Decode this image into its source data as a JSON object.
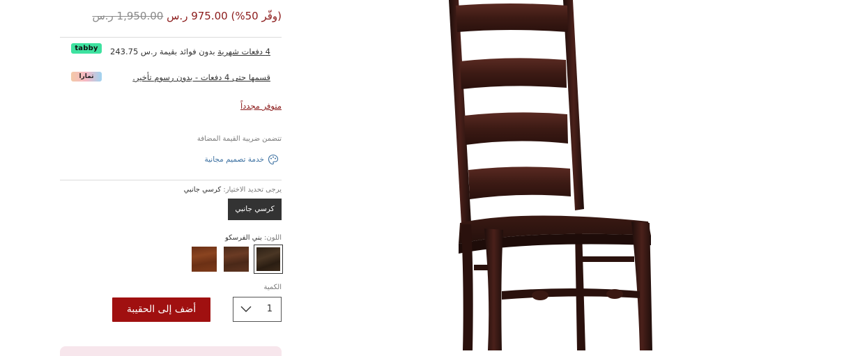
{
  "price": {
    "old": "1,950.00 ر.س",
    "new": "975.00 ر.س",
    "save": "(وفّر 50%)"
  },
  "installments": {
    "tabby_link": "4 دفعات شهرية",
    "tabby_rest": " بدون فوائد بقيمة ر.س 243.75",
    "tabby_logo": "tabby",
    "tabby_color": "#3ee2a0",
    "tamara_text": "قسمها حتى 4 دفعات - بدون رسوم تأخير.",
    "tamara_logo": "تمارا"
  },
  "availability": "متوفر مجدداً",
  "vat_note": "تتضمن ضريبة القيمة المضافة",
  "design_service": {
    "label": "خدمة تصميم مجانية",
    "icon": "palette-icon"
  },
  "option": {
    "prompt": "يرجى تحديد الاختيار:",
    "selected": "كرسي جانبي",
    "button_label": "كرسي جانبي"
  },
  "color": {
    "prompt": "اللون:",
    "selected": "بني الفرسكو",
    "swatches": [
      {
        "name": "espresso",
        "hex": "#3a2a1c"
      },
      {
        "name": "walnut",
        "hex": "#5a3322"
      },
      {
        "name": "mahogany",
        "hex": "#7a3a1c"
      }
    ]
  },
  "quantity": {
    "label": "الكمية",
    "value": "1"
  },
  "add_to_bag": "أضف إلى الحقيبة",
  "colors": {
    "accent": "#a01010",
    "price": "#8b1a1a",
    "dark_button": "#333333"
  }
}
